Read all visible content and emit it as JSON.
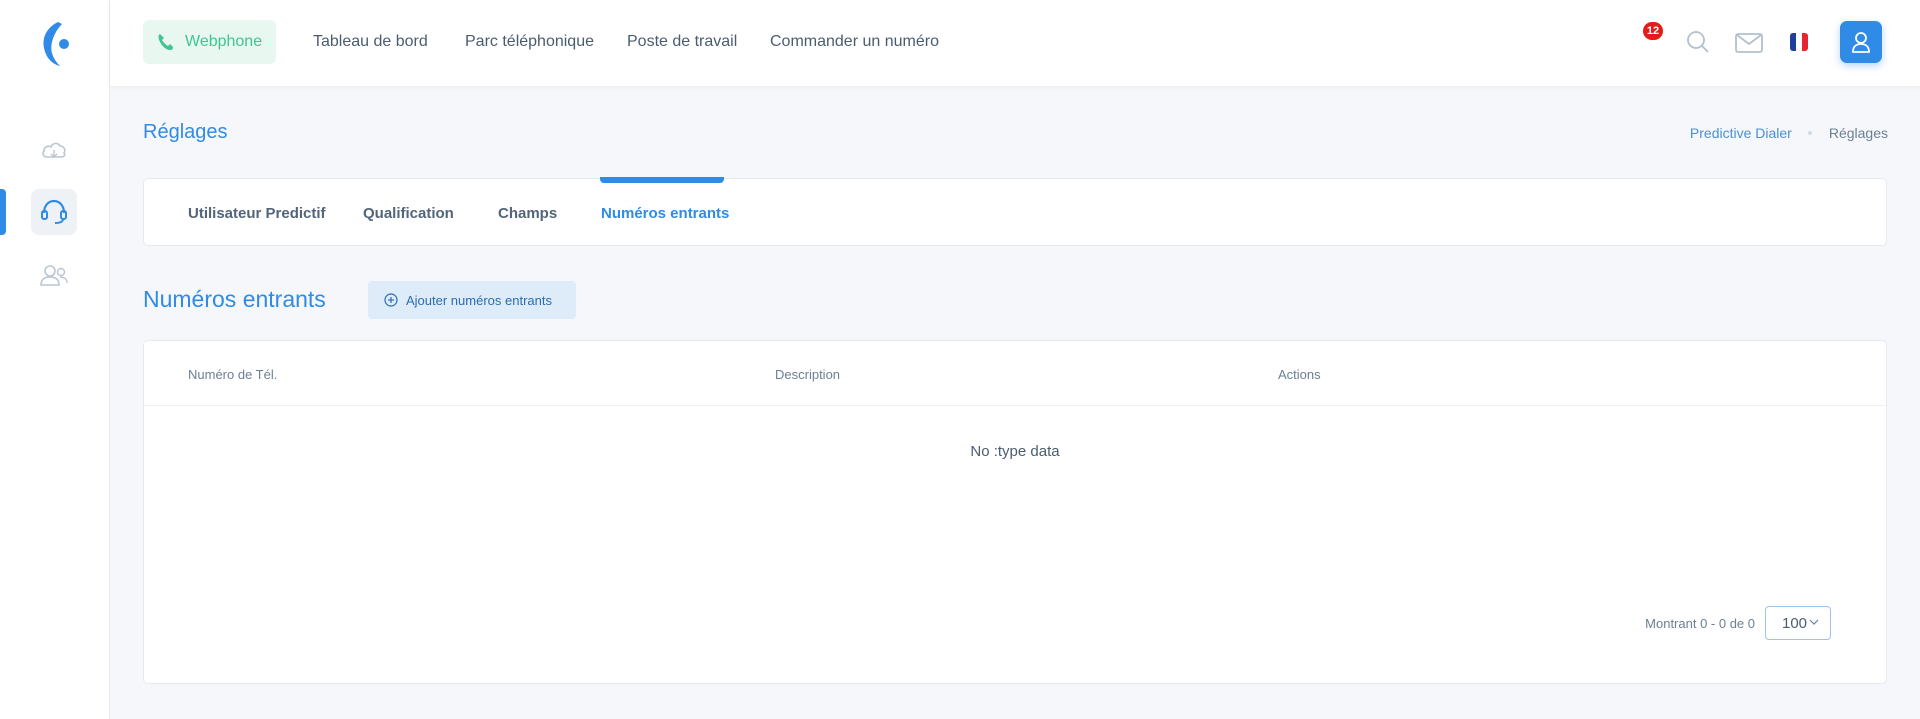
{
  "topbar": {
    "webphone_label": "Webphone",
    "nav": [
      "Tableau de bord",
      "Parc téléphonique",
      "Poste de travail",
      "Commander un numéro"
    ],
    "mail_badge": "12"
  },
  "page": {
    "title": "Réglages",
    "breadcrumb": [
      "Predictive Dialer",
      "Réglages"
    ]
  },
  "tabs": [
    "Utilisateur Predictif",
    "Qualification",
    "Champs",
    "Numéros entrants"
  ],
  "section": {
    "title": "Numéros entrants",
    "add_label": "Ajouter numéros entrants"
  },
  "table": {
    "columns": [
      "Numéro de Tél.",
      "Description",
      "Actions"
    ],
    "empty_text": "No :type data",
    "pager_text": "Montrant 0 - 0 de 0",
    "page_size": "100"
  },
  "colors": {
    "accent": "#2f8be6",
    "webphone_green": "#3fc592",
    "badge_red": "#e31b1b"
  },
  "icons": {
    "sidebar": [
      "cloud-icon",
      "headset-icon",
      "users-icon"
    ],
    "topbar": [
      "phone-icon",
      "search-icon",
      "mail-icon",
      "flag-fr-icon",
      "user-icon"
    ]
  }
}
